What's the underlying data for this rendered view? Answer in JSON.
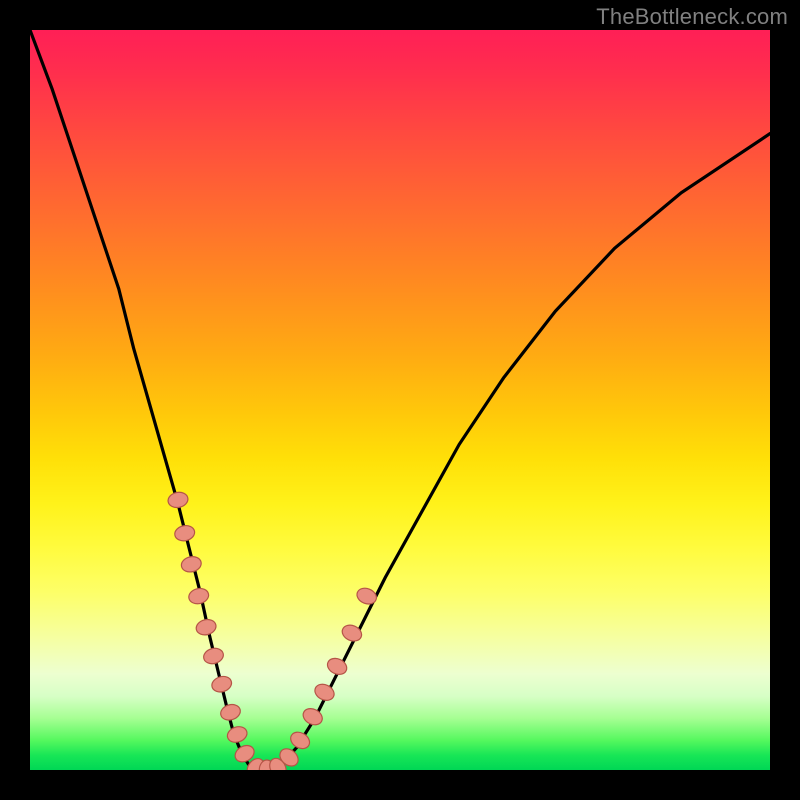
{
  "watermark": "TheBottleneck.com",
  "colors": {
    "bead_fill": "#e88d7f",
    "bead_stroke": "#b55547",
    "curve": "#000000",
    "frame_bg": "#000000"
  },
  "chart_data": {
    "type": "line",
    "title": "",
    "xlabel": "",
    "ylabel": "",
    "xlim": [
      0,
      100
    ],
    "ylim": [
      0,
      100
    ],
    "grid": false,
    "legend": false,
    "x": [
      0,
      3,
      6,
      9,
      12,
      14,
      16,
      18,
      20,
      21.5,
      23,
      24.3,
      25.5,
      26.6,
      27.5,
      28.5,
      29.5,
      30.5,
      32,
      34,
      36,
      38.5,
      41,
      44,
      48,
      53,
      58,
      64,
      71,
      79,
      88,
      100
    ],
    "y": [
      100,
      92,
      83,
      74,
      65,
      57,
      50,
      43,
      36,
      30,
      24,
      18,
      13,
      8.5,
      5,
      2.5,
      0.8,
      0,
      0,
      0.8,
      3,
      7,
      12,
      18,
      26,
      35,
      44,
      53,
      62,
      70.5,
      78,
      86
    ],
    "markers": {
      "comment": "Salmon bead markers drawn along subset of curve at lower region",
      "x": [
        20.0,
        20.9,
        21.8,
        22.8,
        23.8,
        24.8,
        25.9,
        27.1,
        28.0,
        29.0,
        30.5,
        32.0,
        33.5,
        35.0,
        36.5,
        38.2,
        39.8,
        41.5,
        43.5,
        45.5
      ],
      "y": [
        36.5,
        32.0,
        27.8,
        23.5,
        19.3,
        15.4,
        11.6,
        7.8,
        4.8,
        2.2,
        0.3,
        0.0,
        0.3,
        1.7,
        4.0,
        7.2,
        10.5,
        14.0,
        18.5,
        23.5
      ],
      "rx": 7.5,
      "ry": 10.0
    },
    "gradient_note": "Background vertical heatmap: red (high bottleneck, top) through orange/yellow to green (optimal, bottom)."
  }
}
